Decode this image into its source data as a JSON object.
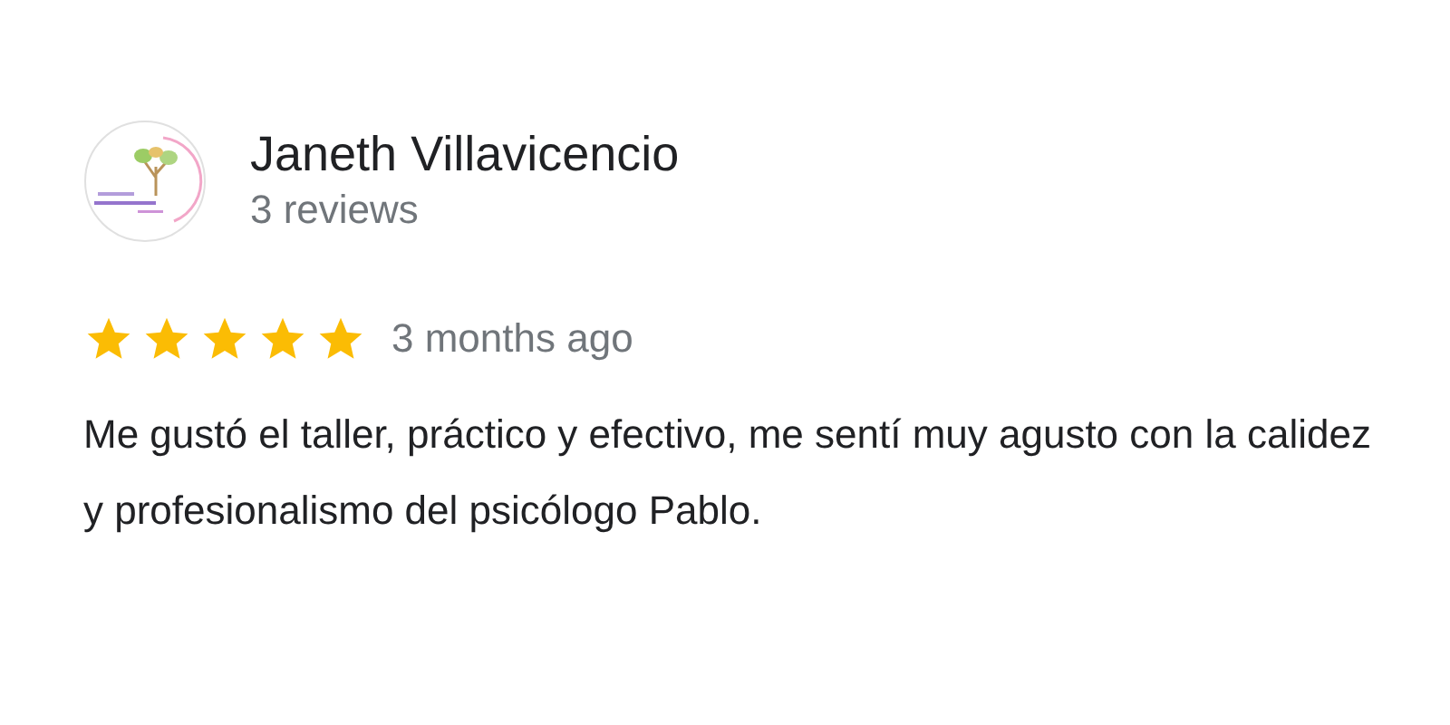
{
  "reviewer": {
    "name": "Janeth Villavicencio",
    "review_count": "3 reviews"
  },
  "review": {
    "stars": 5,
    "time": "3 months ago",
    "text": "Me gustó el taller, práctico y efectivo, me sentí muy agusto con la calidez y profesionalismo del psicólogo Pablo."
  }
}
